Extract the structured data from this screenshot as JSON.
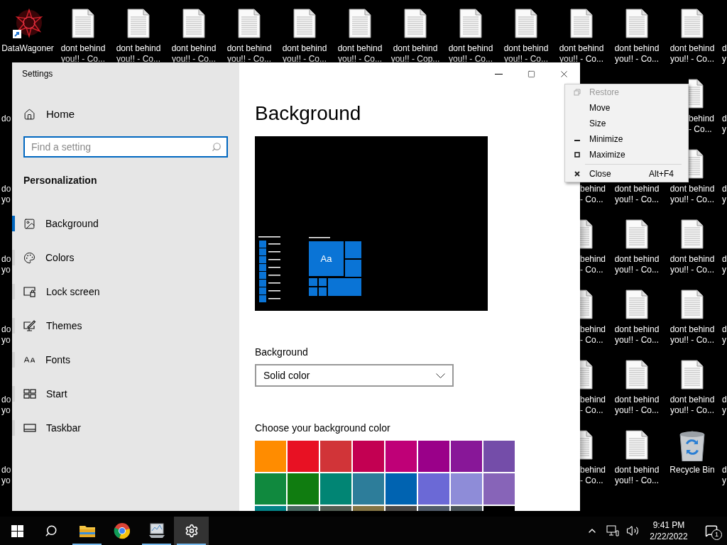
{
  "desktop": {
    "icons": [
      {
        "kind": "shortcut",
        "label": "DataWagoner"
      },
      {
        "kind": "file",
        "label": "dont behind you!! - Co..."
      },
      {
        "kind": "file",
        "label": "dont behind you!! - Co..."
      },
      {
        "kind": "file",
        "label": "dont behind you!! - Co..."
      },
      {
        "kind": "file",
        "label": "dont behind you!! - Co..."
      },
      {
        "kind": "file",
        "label": "dont behind you!! - Co..."
      },
      {
        "kind": "file",
        "label": "dont behind you!! - Co..."
      },
      {
        "kind": "file",
        "label": "dont behind you!! - Cop..."
      },
      {
        "kind": "file",
        "label": "dont behind you!! - Co..."
      },
      {
        "kind": "file",
        "label": "dont behind you!! - Co..."
      },
      {
        "kind": "file",
        "label": "dont behind you!! - Co..."
      },
      {
        "kind": "file",
        "label": "dont behind you!! - Co..."
      },
      {
        "kind": "file",
        "label": "dont behind you!! - Co..."
      },
      {
        "kind": "label",
        "label": "d y"
      },
      {
        "kind": "label",
        "label": "do"
      },
      {
        "kind": "file",
        "label": "behind - Co..."
      },
      {
        "kind": "label",
        "label": "d y"
      },
      {
        "kind": "label",
        "label": "do yo"
      },
      {
        "kind": "label",
        "label": "behind - Co..."
      },
      {
        "kind": "label",
        "label": "dont behind you!! - Co..."
      },
      {
        "kind": "file",
        "label": "dont behind you!! - Co..."
      },
      {
        "kind": "label",
        "label": "d y"
      },
      {
        "kind": "label",
        "label": "do yo"
      },
      {
        "kind": "file",
        "label": "behind - Co..."
      },
      {
        "kind": "file",
        "label": "dont behind you!! - Co..."
      },
      {
        "kind": "file",
        "label": "dont behind you!! - Co..."
      },
      {
        "kind": "label",
        "label": "d y"
      },
      {
        "kind": "label",
        "label": "do yo"
      },
      {
        "kind": "file",
        "label": "behind - Co..."
      },
      {
        "kind": "file",
        "label": "dont behind you!! - Co..."
      },
      {
        "kind": "file",
        "label": "dont behind you!! - Co..."
      },
      {
        "kind": "label",
        "label": "d y"
      },
      {
        "kind": "label",
        "label": "do yo"
      },
      {
        "kind": "file",
        "label": "behind - Co..."
      },
      {
        "kind": "file",
        "label": "dont behind you!! - Co..."
      },
      {
        "kind": "file",
        "label": "dont behind you!! - Co..."
      },
      {
        "kind": "label",
        "label": "d y"
      },
      {
        "kind": "label",
        "label": "do yo"
      },
      {
        "kind": "file",
        "label": "behind - Co..."
      },
      {
        "kind": "file",
        "label": "dont behind you!! - Co..."
      },
      {
        "kind": "recycle_bin",
        "label": "Recycle Bin"
      },
      {
        "kind": "label",
        "label": "d y"
      }
    ]
  },
  "window": {
    "title": "Settings"
  },
  "sidebar": {
    "home": "Home",
    "search": {
      "placeholder": "Find a setting"
    },
    "section": "Personalization",
    "items": [
      {
        "label": "Background",
        "selected": true
      },
      {
        "label": "Colors",
        "selected": false
      },
      {
        "label": "Lock screen",
        "selected": false
      },
      {
        "label": "Themes",
        "selected": false
      },
      {
        "label": "Fonts",
        "selected": false
      },
      {
        "label": "Start",
        "selected": false
      },
      {
        "label": "Taskbar",
        "selected": false
      }
    ]
  },
  "page": {
    "title": "Background",
    "preview_tile": "Aa",
    "background_label": "Background",
    "dropdown": {
      "value": "Solid color"
    },
    "color_label": "Choose your background color",
    "colors": [
      {
        "color": "#ff8c00"
      },
      {
        "color": "#e81123"
      },
      {
        "color": "#d13438"
      },
      {
        "color": "#c30052"
      },
      {
        "color": "#bf0077"
      },
      {
        "color": "#9a0089"
      },
      {
        "color": "#881798"
      },
      {
        "color": "#744da9"
      },
      {
        "color": "#10893e"
      },
      {
        "color": "#107c10"
      },
      {
        "color": "#018574"
      },
      {
        "color": "#2d7d9a"
      },
      {
        "color": "#0063b1"
      },
      {
        "color": "#6b69d6"
      },
      {
        "color": "#8e8cd8"
      },
      {
        "color": "#8764b8"
      },
      {
        "color": "#038387"
      },
      {
        "color": "#486860"
      },
      {
        "color": "#525e54"
      },
      {
        "color": "#847545"
      },
      {
        "color": "#4c4a48"
      },
      {
        "color": "#515c6b"
      },
      {
        "color": "#4a5459"
      },
      {
        "color": "#000000"
      }
    ]
  },
  "context_menu": {
    "items": [
      {
        "kind": "item",
        "label": "Restore",
        "disabled": true
      },
      {
        "kind": "item",
        "label": "Move",
        "disabled": false
      },
      {
        "kind": "item",
        "label": "Size",
        "disabled": false
      },
      {
        "kind": "item",
        "label": "Minimize",
        "disabled": false
      },
      {
        "kind": "item",
        "label": "Maximize",
        "disabled": false
      },
      {
        "kind": "separator"
      },
      {
        "kind": "item",
        "label": "Close",
        "disabled": false,
        "shortcut": "Alt+F4"
      }
    ]
  },
  "taskbar": {
    "apps": [
      {
        "running": true,
        "selected": false
      },
      {
        "running": false,
        "selected": false
      },
      {
        "running": true,
        "selected": false
      },
      {
        "running": true,
        "selected": true
      }
    ],
    "time": "9:41 PM",
    "date": "2/22/2022",
    "notification_count": "1"
  }
}
